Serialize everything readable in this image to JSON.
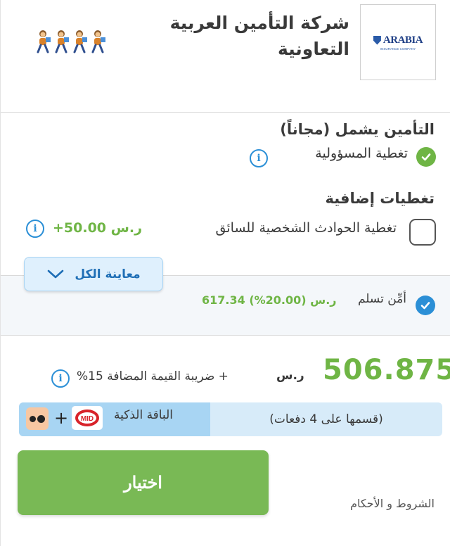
{
  "header": {
    "logo_text": "ARABIA",
    "logo_sub": "INSURANCE COMPANY",
    "company_name": "شركة التأمين العربية التعاونية",
    "rating_count": 4
  },
  "coverage": {
    "included_title": "التأمين يشمل (مجاناً)",
    "included_item": "تغطية المسؤولية",
    "additional_title": "تغطيات إضافية",
    "additional_item": "تغطية الحوادث الشخصية للسائق",
    "additional_price": "+50.00 ر.س",
    "view_all": "معاينة الكل"
  },
  "discount": {
    "text": "أمِّن تسلم",
    "value": "617.34 ر.س (20.00%)"
  },
  "pricing": {
    "total": "506.875",
    "currency": "ر.س",
    "vat_text": "+ ضريبة القيمة المضافة 15%"
  },
  "installments": {
    "split_text": "(قسمها على 4 دفعات)",
    "package_text": "الباقة الذكية",
    "plus": "+",
    "mid_logo": "MID"
  },
  "actions": {
    "select_label": "اختيار",
    "terms_label": "الشروط و الأحكام"
  },
  "colors": {
    "green": "#6fb545",
    "blue": "#2b8fd6",
    "button_green": "#79b955"
  }
}
